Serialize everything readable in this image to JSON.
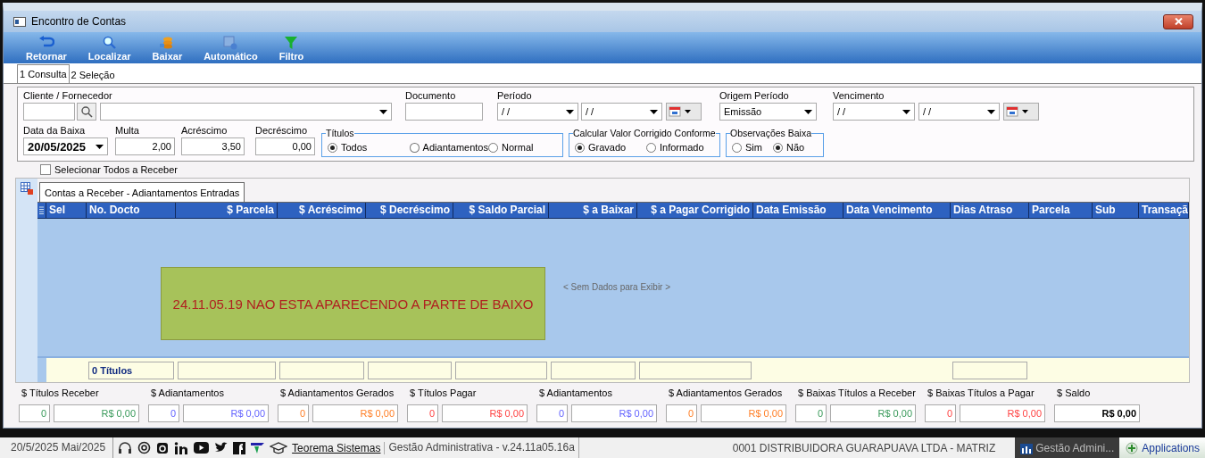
{
  "window": {
    "title": "Encontro de Contas"
  },
  "toolbar": [
    {
      "label": "Retornar"
    },
    {
      "label": "Localizar"
    },
    {
      "label": "Baixar"
    },
    {
      "label": "Automático"
    },
    {
      "label": "Filtro"
    }
  ],
  "tabs": [
    {
      "label": "1 Consulta",
      "selected": true
    },
    {
      "label": "2 Seleção",
      "selected": false
    }
  ],
  "filters": {
    "cliente_label": "Cliente / Fornecedor",
    "documento_label": "Documento",
    "periodo": {
      "label": "Período",
      "from": "/ /",
      "to": "/ /"
    },
    "origem": {
      "label": "Origem Período",
      "value": "Emissão"
    },
    "vencimento": {
      "label": "Vencimento",
      "from": "/ /",
      "to": "/ /"
    },
    "data_baixa": {
      "label": "Data da Baixa",
      "value": "20/05/2025"
    },
    "amounts": [
      {
        "label": "Multa",
        "value": "2,00"
      },
      {
        "label": "Acréscimo",
        "value": "3,50"
      },
      {
        "label": "Decréscimo",
        "value": "0,00"
      }
    ],
    "radio_groups": [
      {
        "title": "Títulos",
        "options": [
          {
            "label": "Todos",
            "selected": true
          },
          {
            "label": "Adiantamentos",
            "selected": false
          },
          {
            "label": "Normal",
            "selected": false
          }
        ]
      },
      {
        "title": "Calcular Valor Corrigido Conforme",
        "options": [
          {
            "label": "Gravado",
            "selected": true
          },
          {
            "label": "Informado",
            "selected": false
          }
        ]
      },
      {
        "title": "Observações Baixa",
        "options": [
          {
            "label": "Sim",
            "selected": false
          },
          {
            "label": "Não",
            "selected": true
          }
        ]
      }
    ]
  },
  "select_all": {
    "label": "Selecionar Todos a Receber",
    "checked": false
  },
  "grid": {
    "tab": "Contas a Receber - Adiantamentos Entradas",
    "columns": [
      {
        "label": "Sel",
        "kind": "text"
      },
      {
        "label": "No. Docto",
        "kind": "text",
        "total": "0 Títulos"
      },
      {
        "label": "$ Parcela",
        "kind": "money",
        "total_box": true
      },
      {
        "label": "$ Acréscimo",
        "kind": "money",
        "total_box": true
      },
      {
        "label": "$ Decréscimo",
        "kind": "money",
        "total_box": true
      },
      {
        "label": "$ Saldo Parcial",
        "kind": "money",
        "total_box": true
      },
      {
        "label": "$ a Baixar",
        "kind": "money",
        "total_box": true
      },
      {
        "label": "$ a Pagar Corrigido",
        "kind": "money",
        "total_box": true
      },
      {
        "label": "Data Emissão",
        "kind": "text"
      },
      {
        "label": "Data Vencimento",
        "kind": "text"
      },
      {
        "label": "Dias Atraso",
        "kind": "text",
        "total_box": true
      },
      {
        "label": "Parcela",
        "kind": "text"
      },
      {
        "label": "Sub",
        "kind": "text"
      },
      {
        "label": "Transaçã",
        "kind": "text"
      }
    ],
    "empty_text": "< Sem Dados para Exibir >",
    "note": "24.11.05.19 NAO ESTA APARECENDO A PARTE DE BAIXO"
  },
  "totals": [
    {
      "label": "$ Títulos Receber",
      "kind": "count_amount",
      "count": "0",
      "amount": "R$ 0,00",
      "color": "#3a9a5b"
    },
    {
      "label": "$ Adiantamentos",
      "kind": "count_amount",
      "count": "0",
      "amount": "R$ 0,00",
      "color": "#6464ff"
    },
    {
      "label": "$ Adiantamentos Gerados",
      "kind": "count_amount",
      "count": "0",
      "amount": "R$ 0,00",
      "color": "#ff7f27"
    },
    {
      "label": "$ Títulos Pagar",
      "kind": "count_amount",
      "count": "0",
      "amount": "R$ 0,00",
      "color": "#ff4444"
    },
    {
      "label": "$ Adiantamentos",
      "kind": "count_amount",
      "count": "0",
      "amount": "R$ 0,00",
      "color": "#6464ff"
    },
    {
      "label": "$ Adiantamentos Gerados",
      "kind": "count_amount",
      "count": "0",
      "amount": "R$ 0,00",
      "color": "#ff7f27"
    },
    {
      "label": "$ Baixas Títulos a Receber",
      "kind": "count_amount",
      "count": "0",
      "amount": "R$ 0,00",
      "color": "#3a9a5b"
    },
    {
      "label": "$ Baixas Títulos a Pagar",
      "kind": "count_amount",
      "count": "0",
      "amount": "R$ 0,00",
      "color": "#ff4444"
    },
    {
      "label": "$ Saldo",
      "kind": "amount",
      "amount": "R$ 0,00",
      "color": "#000000"
    }
  ],
  "status_bar": {
    "date": "20/5/2025 Mai/2025",
    "link": "Teorema Sistemas",
    "version": "Gestão Administrativa - v.24.11a05.16a",
    "company": "0001 DISTRIBUIDORA GUARAPUAVA LTDA - MATRIZ",
    "taskbar": [
      {
        "label": "Gestão Admini...",
        "selected": true
      },
      {
        "label": "Applications",
        "selected": false
      }
    ]
  }
}
